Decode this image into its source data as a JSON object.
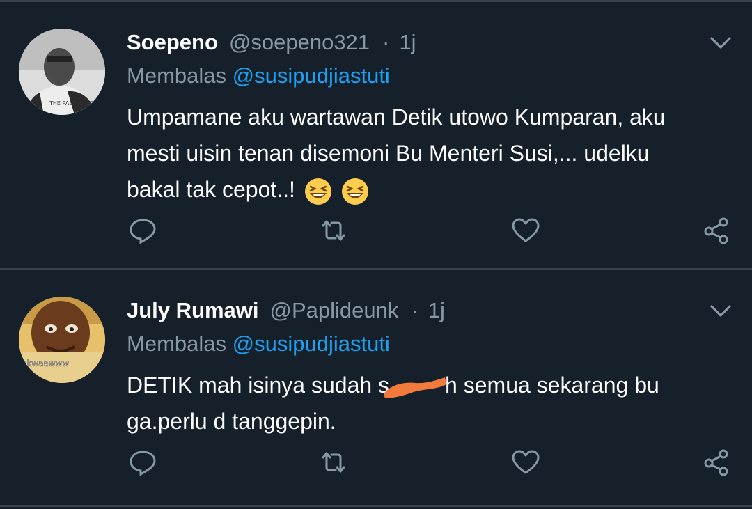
{
  "tweets": [
    {
      "name": "Soepeno",
      "handle": "@soepeno321",
      "separator": "·",
      "time": "1j",
      "reply_prefix": "Membalas",
      "reply_to": "@susipudjiastuti",
      "text_line1": "Umpamane aku wartawan Detik utowo Kumparan, aku",
      "text_line2": "mesti uisin tenan disemoni Bu Menteri Susi,... udelku",
      "text_line3": "bakal tak cepot..!",
      "emojis": [
        "grinning-squinting-face-emoji",
        "grinning-squinting-face-emoji"
      ],
      "avatar_shirt_text": "THE PAST IS DONE"
    },
    {
      "name": "July Rumawi",
      "handle": "@Paplideunk",
      "separator": "·",
      "time": "1j",
      "reply_prefix": "Membalas",
      "reply_to": "@susipudjiastuti",
      "text_line1_a": "DETIK mah isinya sudah s",
      "text_line1_b": "h semua sekarang bu",
      "text_line2": "ga.perlu d tanggepin.",
      "avatar_caption": "akwaawww"
    }
  ],
  "icons": [
    "chevron-down-icon",
    "reply-icon",
    "retweet-icon",
    "like-icon",
    "share-icon"
  ],
  "colors": {
    "background": "#15202b",
    "divider": "#38444d",
    "secondary_text": "#8899a6",
    "mention": "#1da1f2",
    "redaction": "#f47a3c"
  }
}
